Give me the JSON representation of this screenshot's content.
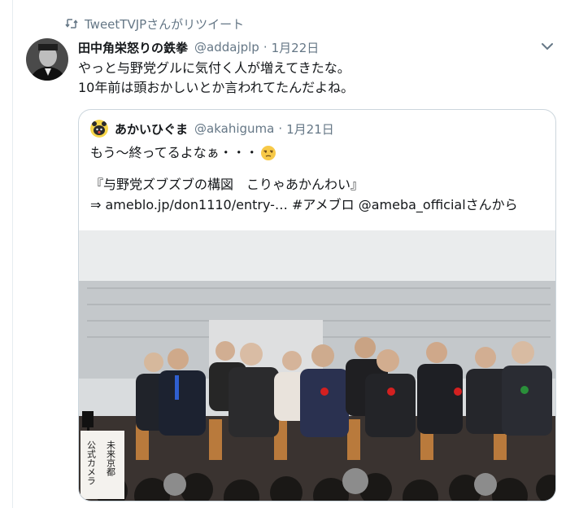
{
  "retweet": {
    "icon": "retweet-icon",
    "text": "TweetTVJPさんがリツイート"
  },
  "tweet": {
    "avatar": "avatar",
    "name": "田中角栄怒りの鉄拳",
    "handle": "@addajplp",
    "separator": "·",
    "date": "1月22日",
    "menu_icon": "chevron-down-icon",
    "lines": [
      "やっと与野党グルに気付く人が増えてきたな。",
      "10年前は頭おかしいとか言われてたんだよね。"
    ]
  },
  "quote": {
    "name": "あかいひぐま",
    "handle": "@akahiguma",
    "separator": "·",
    "date": "1月21日",
    "line1": "もう〜終ってるよなぁ・・・",
    "emoji": "unamused-face-emoji",
    "line2": "『与野党ズブズブの構図　こりゃあかんわい』",
    "arrow": "⇒",
    "url": "ameblo.jp/don1110/entry-…",
    "hashtag": "#アメブロ",
    "mention": "@ameba_official",
    "suffix": "さんから",
    "photo": {
      "caption_left": "公式カメラ",
      "caption_right": "未来京都"
    }
  },
  "colors": {
    "text": "#14171a",
    "muted": "#657786",
    "border": "#ccd6dd"
  }
}
